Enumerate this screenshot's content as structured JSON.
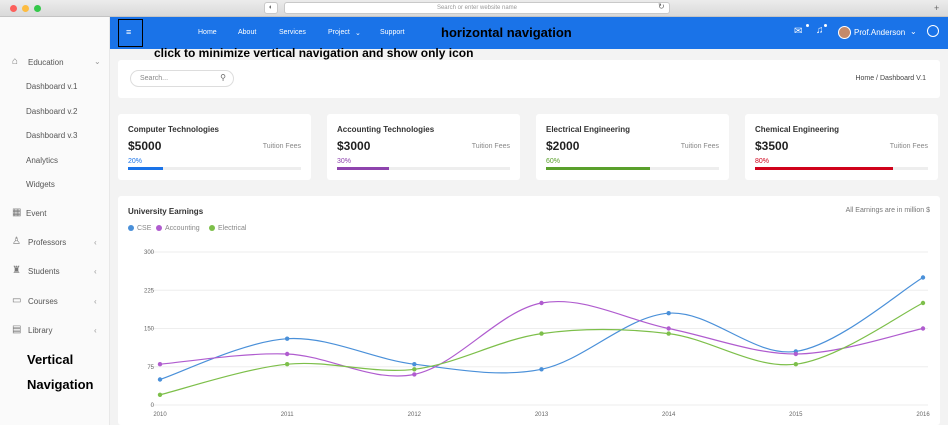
{
  "browser": {
    "address_placeholder": "Search or enter website name"
  },
  "topnav": {
    "links": [
      "Home",
      "About",
      "Services",
      "Project",
      "Support"
    ],
    "user": "Prof.Anderson"
  },
  "annotations": {
    "horizontal": "horizontal navigation",
    "minimize": "click to minimize vertical navigation and show only icon",
    "vertical_1": "Vertical",
    "vertical_2": "Navigation"
  },
  "sidebar": {
    "education": "Education",
    "sub": [
      "Dashboard v.1",
      "Dashboard v.2",
      "Dashboard v.3",
      "Analytics",
      "Widgets"
    ],
    "event": "Event",
    "professors": "Professors",
    "students": "Students",
    "courses": "Courses",
    "library": "Library"
  },
  "search": {
    "placeholder": "Search..."
  },
  "breadcrumb": "Home / Dashboard V.1",
  "fees": [
    {
      "title": "Computer Technologies",
      "amount": "$5000",
      "label": "Tuition Fees",
      "percent": "20%",
      "fill": 0.2,
      "color": "#1a73e8"
    },
    {
      "title": "Accounting Technologies",
      "amount": "$3000",
      "label": "Tuition Fees",
      "percent": "30%",
      "fill": 0.3,
      "color": "#8e44ad"
    },
    {
      "title": "Electrical Engineering",
      "amount": "$2000",
      "label": "Tuition Fees",
      "percent": "60%",
      "fill": 0.6,
      "color": "#5aa02c"
    },
    {
      "title": "Chemical Engineering",
      "amount": "$3500",
      "label": "Tuition Fees",
      "percent": "80%",
      "fill": 0.8,
      "color": "#d0021b"
    }
  ],
  "chart_data": {
    "type": "line",
    "title": "University Earnings",
    "note": "All Earnings are in million $",
    "x": [
      "2010",
      "2011",
      "2012",
      "2013",
      "2014",
      "2015",
      "2016"
    ],
    "ylim": [
      0,
      300
    ],
    "yticks": [
      "0",
      "75",
      "150",
      "225",
      "300"
    ],
    "series": [
      {
        "name": "CSE",
        "color": "#4a90d9",
        "values": [
          50,
          130,
          80,
          70,
          180,
          105,
          250
        ]
      },
      {
        "name": "Accounting",
        "color": "#b05ccf",
        "values": [
          80,
          100,
          60,
          200,
          150,
          100,
          150
        ]
      },
      {
        "name": "Electrical",
        "color": "#7dbf4a",
        "values": [
          20,
          80,
          70,
          140,
          140,
          80,
          200
        ]
      }
    ]
  }
}
